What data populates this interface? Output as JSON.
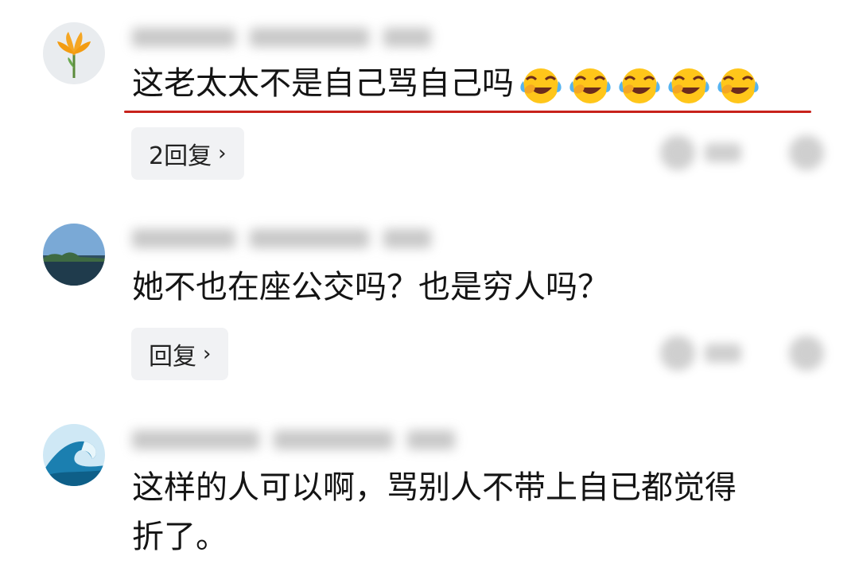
{
  "comments": [
    {
      "text": "这老太太不是自己骂自己吗",
      "emoji_count": 5,
      "emoji_icon": "laughing-crying-face-icon",
      "reply_label": "2回复",
      "highlight_color": "#c8221b"
    },
    {
      "text": "她不也在座公交吗？也是穷人吗？",
      "reply_label": "回复"
    },
    {
      "text_line1": "这样的人可以啊，骂别人不带上自已都觉得",
      "text_line2": "折了。"
    }
  ]
}
